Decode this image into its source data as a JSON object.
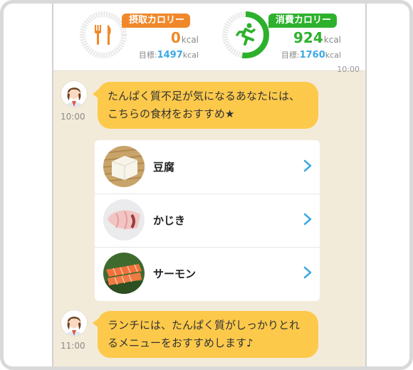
{
  "header": {
    "intake": {
      "label": "摂取カロリー",
      "value": "0",
      "unit": "kcal",
      "goal_label": "目標:",
      "goal_value": "1497",
      "goal_unit": "kcal",
      "progress": 0
    },
    "burn": {
      "label": "消費カロリー",
      "value": "924",
      "unit": "kcal",
      "goal_label": "目標:",
      "goal_value": "1760",
      "goal_unit": "kcal",
      "progress": 0.525
    }
  },
  "chat": {
    "top_time": "10:00",
    "messages": [
      {
        "time": "10:00",
        "text": "たんぱく質不足が気になるあなたには、こちらの食材をおすすめ★"
      },
      {
        "time": "11:00",
        "text": "ランチには、たんぱく質がしっかりとれるメニューをおすすめします♪"
      }
    ],
    "foods": [
      {
        "name": "豆腐",
        "image": "tofu"
      },
      {
        "name": "かじき",
        "image": "swordfish"
      },
      {
        "name": "サーモン",
        "image": "salmon"
      }
    ]
  },
  "colors": {
    "intake_accent": "#f0882a",
    "burn_accent": "#2db12d",
    "goal_value": "#3ca8e6",
    "bubble": "#fcc94b",
    "chat_bg": "#f3ebd9",
    "chevron": "#3ca8e6"
  }
}
